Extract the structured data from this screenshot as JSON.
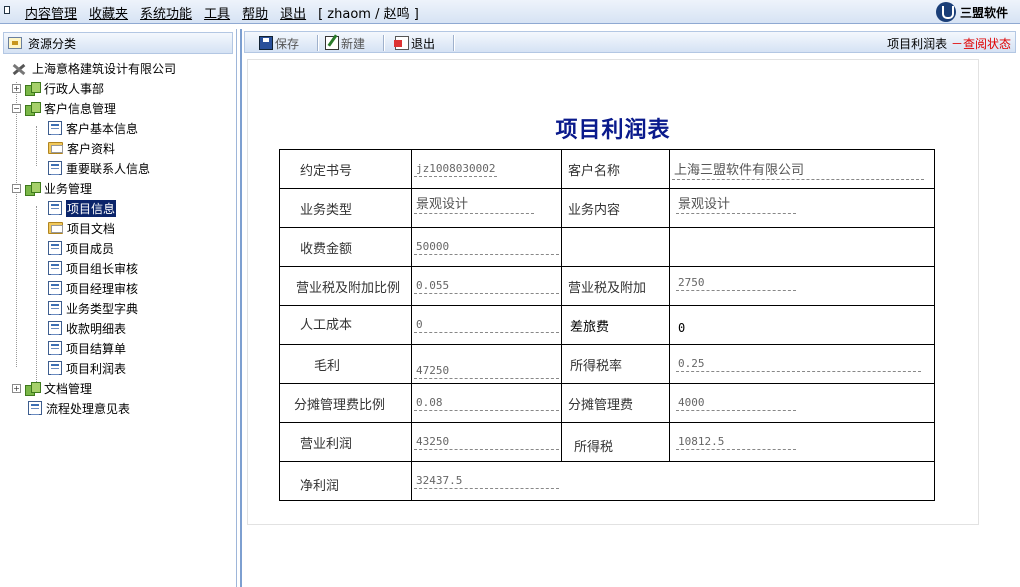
{
  "menu": {
    "items": [
      "内容管理",
      "收藏夹",
      "系统功能",
      "工具",
      "帮助",
      "退出"
    ],
    "user": "[ zhaom / 赵鸣 ]"
  },
  "brand": {
    "name": "三盟软件"
  },
  "sidebar": {
    "title": "资源分类",
    "tree": [
      {
        "label": "上海意格建筑设计有限公司",
        "icon": "tools-icon"
      },
      {
        "label": "行政人事部",
        "icon": "group-icon"
      },
      {
        "label": "客户信息管理",
        "icon": "group-icon"
      },
      {
        "label": "客户基本信息",
        "icon": "document-icon"
      },
      {
        "label": "客户资料",
        "icon": "folder-icon"
      },
      {
        "label": "重要联系人信息",
        "icon": "document-icon"
      },
      {
        "label": "业务管理",
        "icon": "group-icon"
      },
      {
        "label": "项目信息",
        "icon": "document-icon",
        "selected": true
      },
      {
        "label": "项目文档",
        "icon": "folder-icon"
      },
      {
        "label": "项目成员",
        "icon": "document-icon"
      },
      {
        "label": "项目组长审核",
        "icon": "document-icon"
      },
      {
        "label": "项目经理审核",
        "icon": "document-icon"
      },
      {
        "label": "业务类型字典",
        "icon": "document-icon"
      },
      {
        "label": "收款明细表",
        "icon": "document-icon"
      },
      {
        "label": "项目结算单",
        "icon": "document-icon"
      },
      {
        "label": "项目利润表",
        "icon": "document-icon"
      },
      {
        "label": "文档管理",
        "icon": "group-icon"
      },
      {
        "label": "流程处理意见表",
        "icon": "document-icon"
      }
    ]
  },
  "toolbar": {
    "save": "保存",
    "new": "新建",
    "exit": "退出",
    "page_name": "项目利润表",
    "status": "－查阅状态"
  },
  "form": {
    "title": "项目利润表",
    "fields": {
      "contract_no_label": "约定书号",
      "contract_no": "jz1008030002",
      "client_label": "客户名称",
      "client": "上海三盟软件有限公司",
      "biz_type_label": "业务类型",
      "biz_type": "景观设计",
      "biz_content_label": "业务内容",
      "biz_content": "景观设计",
      "fee_label": "收费金额",
      "fee": "50000",
      "tax_ratio_label": "营业税及附加比例",
      "tax_ratio": "0.055",
      "tax_label": "营业税及附加",
      "tax": "2750",
      "labor_label": "人工成本",
      "labor": "0",
      "travel_label": "差旅费",
      "travel": "0",
      "gross_label": "毛利",
      "gross": "47250",
      "income_tax_rate_label": "所得税率",
      "income_tax_rate": "0.25",
      "mgmt_ratio_label": "分摊管理费比例",
      "mgmt_ratio": "0.08",
      "mgmt_fee_label": "分摊管理费",
      "mgmt_fee": "4000",
      "op_profit_label": "营业利润",
      "op_profit": "43250",
      "income_tax_label": "所得税",
      "income_tax": "10812.5",
      "net_profit_label": "净利润",
      "net_profit": "32437.5"
    }
  }
}
